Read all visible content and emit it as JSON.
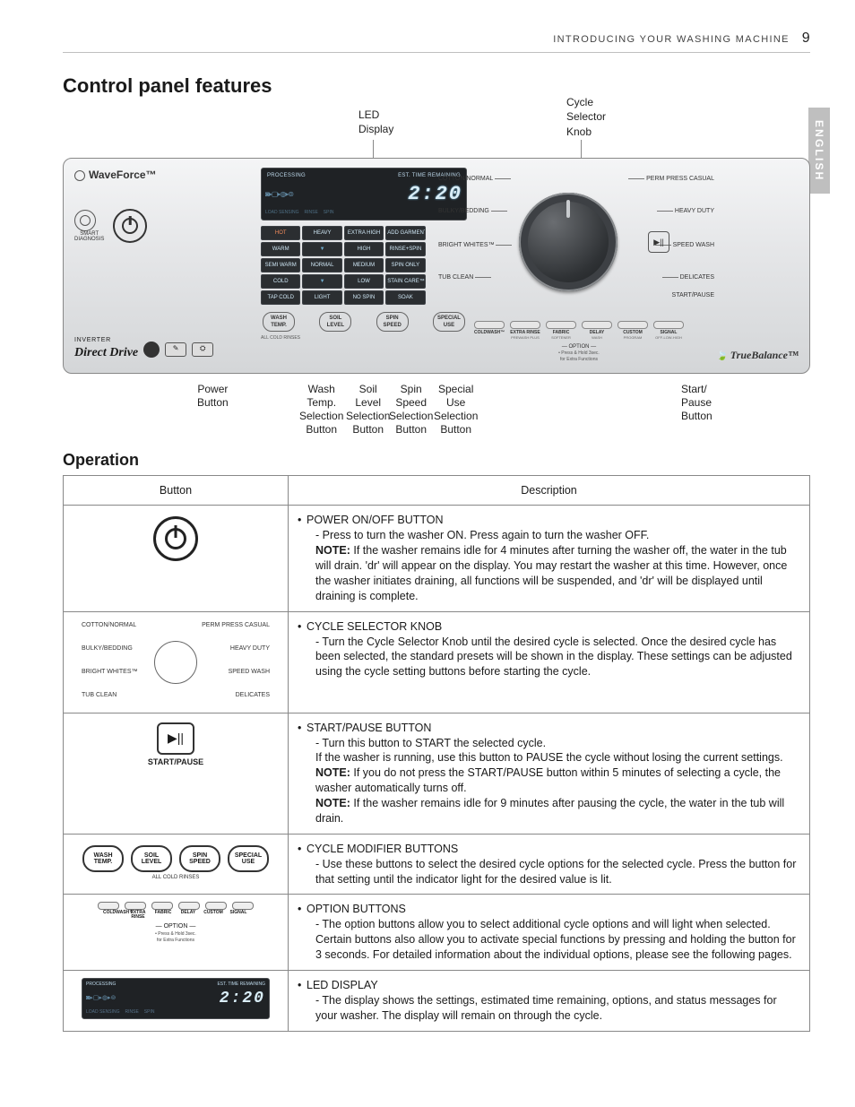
{
  "header": {
    "section": "INTRODUCING YOUR WASHING MACHINE",
    "page_number": "9"
  },
  "lang_tab": "ENGLISH",
  "titles": {
    "main": "Control panel features",
    "operation": "Operation"
  },
  "callouts_top": {
    "led": "LED\nDisplay",
    "knob": "Cycle\nSelector\nKnob"
  },
  "callouts_bot": {
    "power": "Power\nButton",
    "wash": "Wash\nTemp.\nSelection\nButton",
    "soil": "Soil\nLevel\nSelection\nButton",
    "spin": "Spin\nSpeed\nSelection\nButton",
    "special": "Special\nUse\nSelection\nButton",
    "start": "Start/\nPause\nButton"
  },
  "panel": {
    "waveforce": "WaveForce™",
    "smart_diag": "SMART\nDIAGNOSIS",
    "inverter": "INVERTER",
    "direct_drive": "Direct Drive",
    "truebalance": "TrueBalance™",
    "display": {
      "hdr_left": "PROCESSING",
      "hdr_right": "EST. TIME REMAINING",
      "time": "2:20",
      "strip": [
        "LOAD SENSING",
        "RINSE",
        "SPIN"
      ]
    },
    "grid": [
      [
        "HOT",
        "HEAVY",
        "EXTRA HIGH",
        "ADD GARMENTS",
        ""
      ],
      [
        "WARM",
        "▼",
        "HIGH",
        "RINSE+SPIN",
        ""
      ],
      [
        "SEMI WARM",
        "NORMAL",
        "MEDIUM",
        "SPIN ONLY",
        ""
      ],
      [
        "COLD",
        "▼",
        "LOW",
        "STAIN CARE™",
        ""
      ],
      [
        "TAP COLD",
        "LIGHT",
        "NO SPIN",
        "SOAK",
        ""
      ]
    ],
    "mods": [
      {
        "l1": "WASH",
        "l2": "TEMP."
      },
      {
        "l1": "SOIL",
        "l2": "LEVEL"
      },
      {
        "l1": "SPIN",
        "l2": "SPEED"
      },
      {
        "l1": "SPECIAL",
        "l2": "USE"
      }
    ],
    "mod_sub": "ALL COLD RINSES",
    "cycles_left": [
      "COTTON/NORMAL",
      "BULKY/BEDDING",
      "BRIGHT WHITES™",
      "TUB CLEAN"
    ],
    "cycles_right": [
      "PERM PRESS CASUAL",
      "HEAVY DUTY",
      "SPEED WASH",
      "DELICATES"
    ],
    "start_pause_glyph": "▶||",
    "start_pause_caption": "START/PAUSE",
    "options": [
      {
        "l": "COLDWASH™",
        "s": ""
      },
      {
        "l": "EXTRA RINSE",
        "s": "PREWASH PLUS"
      },
      {
        "l": "FABRIC",
        "s": "SOFTENER"
      },
      {
        "l": "DELAY",
        "s": "WASH"
      },
      {
        "l": "CUSTOM",
        "s": "PROGRAM"
      },
      {
        "l": "SIGNAL",
        "s": "OFF-LOW-HIGH"
      }
    ],
    "option_caption": "— OPTION —",
    "option_sub": "• Press & Hold 3sec.\nfor Extra Functions"
  },
  "table": {
    "head": {
      "button": "Button",
      "desc": "Description"
    },
    "rows": [
      {
        "icon": "power",
        "title": "POWER ON/OFF BUTTON",
        "lines": [
          "- Press to turn the washer ON. Press again to turn the washer OFF."
        ],
        "note": "If the washer remains idle for 4 minutes after turning the washer off, the water in the tub will drain. 'dr' will appear on the display. You may restart the washer at this time. However, once the washer initiates draining, all functions will be suspended, and 'dr' will be displayed until draining is complete."
      },
      {
        "icon": "knob",
        "title": "CYCLE SELECTOR KNOB",
        "lines": [
          "- Turn the Cycle Selector Knob until the desired cycle is selected. Once the desired cycle has been selected, the standard presets will be shown in the display. These settings can be adjusted using the cycle setting buttons before starting the cycle."
        ]
      },
      {
        "icon": "startpause",
        "title": "START/PAUSE BUTTON",
        "lines": [
          "- Turn this button to START the selected cycle.",
          "If the washer is running, use this button to PAUSE the cycle without losing the current settings."
        ],
        "note": "If you do not press the START/PAUSE button within 5 minutes of selecting a cycle, the washer automatically turns off.",
        "note2": "If the washer remains idle for 9 minutes after pausing the cycle, the water in the tub will drain."
      },
      {
        "icon": "mods",
        "title": "CYCLE MODIFIER BUTTONS",
        "lines": [
          "- Use these buttons to select the desired cycle options for the selected cycle. Press the button for that setting until the indicator light for the desired value is lit."
        ]
      },
      {
        "icon": "options",
        "title": "OPTION BUTTONS",
        "lines": [
          "- The option buttons allow you to select additional cycle options and will light when selected. Certain buttons also allow you to activate special functions by pressing and holding the button for 3 seconds. For detailed information about the individual options, please see the following pages."
        ]
      },
      {
        "icon": "led",
        "title": "LED DISPLAY",
        "lines": [
          "- The display shows the settings, estimated  time remaining, options, and status messages for your washer. The display will remain on through the cycle."
        ]
      }
    ]
  }
}
